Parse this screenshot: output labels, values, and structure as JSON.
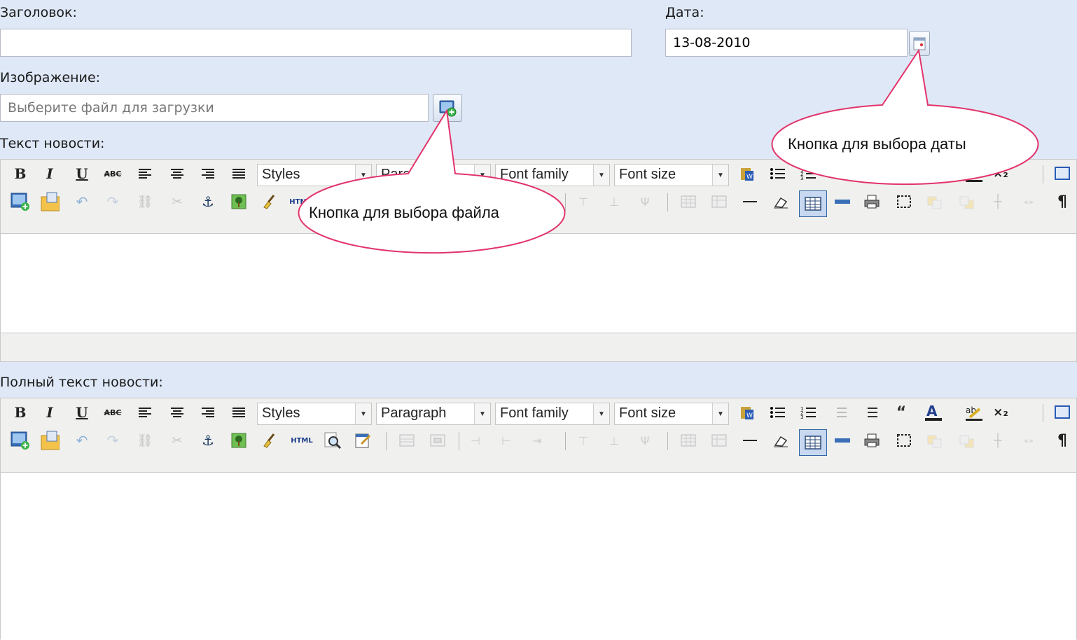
{
  "form": {
    "title_label": "Заголовок:",
    "title_value": "",
    "date_label": "Дата:",
    "date_value": "13-08-2010",
    "image_label": "Изображение:",
    "image_placeholder": "Выберите файл для загрузки",
    "news_text_label": "Текст новости:",
    "full_text_label": "Полный текст новости:"
  },
  "toolbar": {
    "styles": "Styles",
    "paragraph": "Paragraph",
    "font_family": "Font family",
    "font_size": "Font size",
    "bold": "B",
    "italic": "I",
    "underline": "U",
    "strike": "ABC",
    "html": "HTML"
  },
  "callouts": {
    "date_button": "Кнопка для выбора даты",
    "file_button": "Кнопка для выбора файла"
  },
  "colors": {
    "page_bg": "#dfe8f6",
    "callout_border": "#e2336b",
    "editor_toolbar_bg": "#f0f0ee"
  }
}
